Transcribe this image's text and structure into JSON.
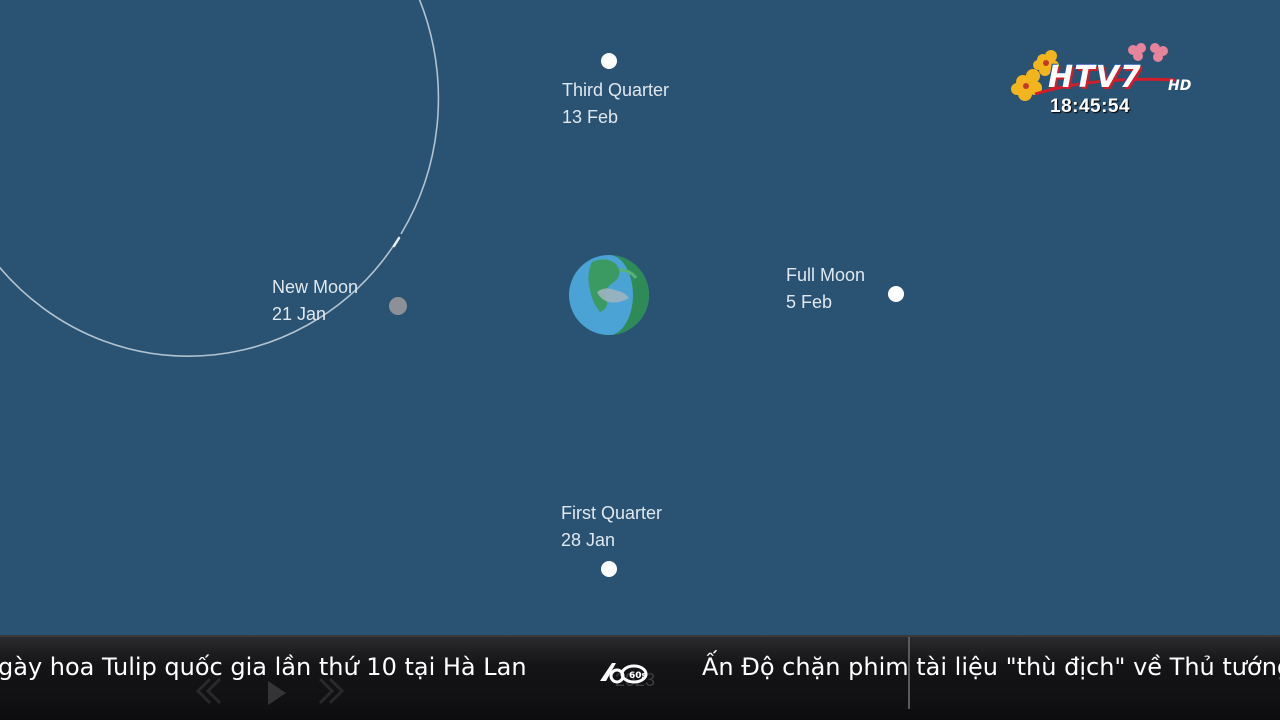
{
  "diagram": {
    "phases": {
      "third_quarter": {
        "name": "Third Quarter",
        "date": "13 Feb"
      },
      "new_moon": {
        "name": "New Moon",
        "date": "21 Jan"
      },
      "full_moon": {
        "name": "Full Moon",
        "date": "5 Feb"
      },
      "first_quarter": {
        "name": "First Quarter",
        "date": "28 Jan"
      }
    },
    "colors": {
      "background": "#2a5272",
      "orbit": "#c9d6e0",
      "moon": "#ffffff",
      "new_moon": "#8d9096",
      "earth_ocean": "#4aa3d4",
      "earth_land": "#2e8a56"
    },
    "icons": [
      "earth-icon",
      "moon-icon"
    ]
  },
  "overlay": {
    "channel_logo": "HTV7",
    "channel_suffix": "HD",
    "clock": "18:45:54"
  },
  "ticker": {
    "item_1": "gày hoa Tulip quốc gia lần thứ 10 tại Hà Lan",
    "item_2": "Ấn Độ chặn phim tài liệu \"thù địch\" về Thủ tướng",
    "separator_logo": "60s",
    "ghost_year": "2023"
  }
}
